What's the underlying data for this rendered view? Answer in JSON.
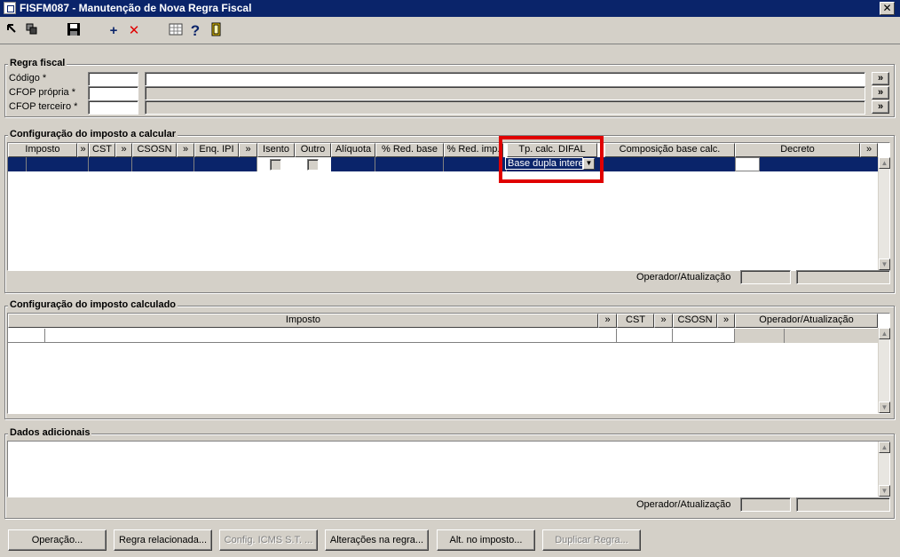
{
  "window": {
    "title": "FISFM087 - Manutenção de Nova Regra Fiscal",
    "close_glyph": "✕"
  },
  "toolbar": {
    "icons": [
      "first-icon",
      "copy-icon",
      "save-icon",
      "add-icon",
      "delete-icon",
      "grid-icon",
      "help-icon",
      "exit-icon"
    ],
    "add_glyph": "+",
    "delete_glyph": "✕",
    "help_glyph": "?"
  },
  "regra_fiscal": {
    "legend": "Regra fiscal",
    "codigo_label": "Código *",
    "cfop_propria_label": "CFOP própria *",
    "cfop_terceiro_label": "CFOP terceiro *",
    "lookup_glyph": "»"
  },
  "config_calcular": {
    "legend": "Configuração do imposto a calcular",
    "columns": [
      "Imposto",
      "»",
      "CST",
      "»",
      "CSOSN",
      "»",
      "Enq. IPI",
      "»",
      "Isento",
      "Outro",
      "Alíquota",
      "% Red. base",
      "% Red. imp.",
      "Tp. calc. DIFAL",
      "Composição base calc.",
      "Decreto",
      "»"
    ],
    "difal_value": "Base dupla intere",
    "operador_label": "Operador/Atualização"
  },
  "config_calculado": {
    "legend": "Configuração do imposto calculado",
    "columns": [
      "Imposto",
      "»",
      "CST",
      "»",
      "CSOSN",
      "»",
      "Operador/Atualização"
    ]
  },
  "dados_adicionais": {
    "legend": "Dados adicionais",
    "operador_label": "Operador/Atualização"
  },
  "buttons": {
    "operacao": "Operação...",
    "regra_relacionada": "Regra relacionada...",
    "config_icms": "Config. ICMS S.T. ...",
    "alteracoes": "Alterações na regra...",
    "alt_imposto": "Alt. no imposto...",
    "duplicar": "Duplicar Regra..."
  },
  "colors": {
    "title_bar": "#0a246a",
    "selection": "#0a246a",
    "highlight_box": "#e00000",
    "face": "#d4d0c8"
  }
}
